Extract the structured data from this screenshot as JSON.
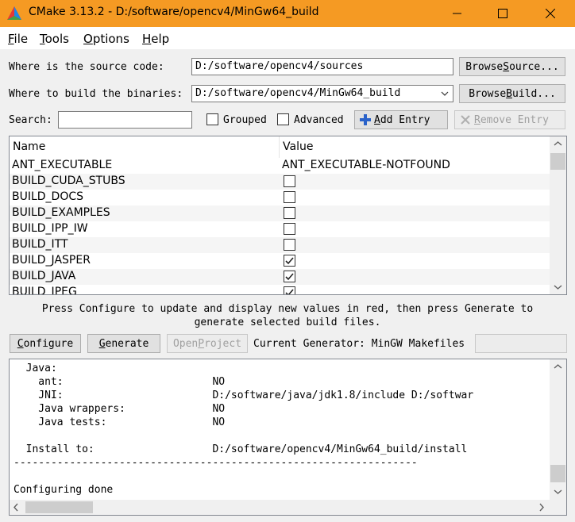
{
  "window": {
    "title": "CMake 3.13.2 - D:/software/opencv4/MinGw64_build",
    "minimize_icon": "minimize-icon",
    "maximize_icon": "maximize-icon",
    "close_icon": "close-icon"
  },
  "menu": [
    {
      "mnem": "F",
      "rest": "ile"
    },
    {
      "mnem": "T",
      "rest": "ools"
    },
    {
      "mnem": "O",
      "rest": "ptions"
    },
    {
      "mnem": "H",
      "rest": "elp"
    }
  ],
  "source": {
    "label": "Where is the source code:",
    "value": "D:/software/opencv4/sources",
    "browse_pre": "Browse ",
    "browse_mnem": "S",
    "browse_post": "ource..."
  },
  "build": {
    "label": "Where to build the binaries:",
    "value": "D:/software/opencv4/MinGw64_build",
    "browse_pre": "Browse ",
    "browse_mnem": "B",
    "browse_post": "uild..."
  },
  "search": {
    "label": "Search:",
    "value": "",
    "grouped": "Grouped",
    "advanced": "Advanced",
    "add_mnem": "A",
    "add_rest": "dd Entry",
    "remove_mnem": "R",
    "remove_rest": "emove Entry"
  },
  "table": {
    "col_name": "Name",
    "col_value": "Value",
    "rows": [
      {
        "name": "ANT_EXECUTABLE",
        "value": "ANT_EXECUTABLE-NOTFOUND"
      },
      {
        "name": "BUILD_CUDA_STUBS",
        "checked": false
      },
      {
        "name": "BUILD_DOCS",
        "checked": false
      },
      {
        "name": "BUILD_EXAMPLES",
        "checked": false
      },
      {
        "name": "BUILD_IPP_IW",
        "checked": false
      },
      {
        "name": "BUILD_ITT",
        "checked": false
      },
      {
        "name": "BUILD_JASPER",
        "checked": true
      },
      {
        "name": "BUILD_JAVA",
        "checked": true
      },
      {
        "name": "BUILD_JPEG",
        "checked": true
      }
    ]
  },
  "hint": {
    "line1": "Press Configure to update and display new values in red, then press Generate to",
    "line2": "generate selected build files."
  },
  "actions": {
    "configure_mnem": "C",
    "configure_rest": "onfigure",
    "generate_mnem": "G",
    "generate_rest": "enerate",
    "open_pre": "Open ",
    "open_mnem": "P",
    "open_post": "roject",
    "generator": "Current Generator: MinGW Makefiles",
    "generator_field": ""
  },
  "output": {
    "lines": [
      "  Java:",
      "    ant:                        NO",
      "    JNI:                        D:/software/java/jdk1.8/include D:/softwar",
      "    Java wrappers:              NO",
      "    Java tests:                 NO",
      "",
      "  Install to:                   D:/software/opencv4/MinGw64_build/install",
      "-----------------------------------------------------------------",
      "",
      "Configuring done"
    ]
  },
  "colors": {
    "titlebar": "#f59a23",
    "row_alt": "#f5f5f5",
    "scrollbar": "#cdcdcd"
  }
}
